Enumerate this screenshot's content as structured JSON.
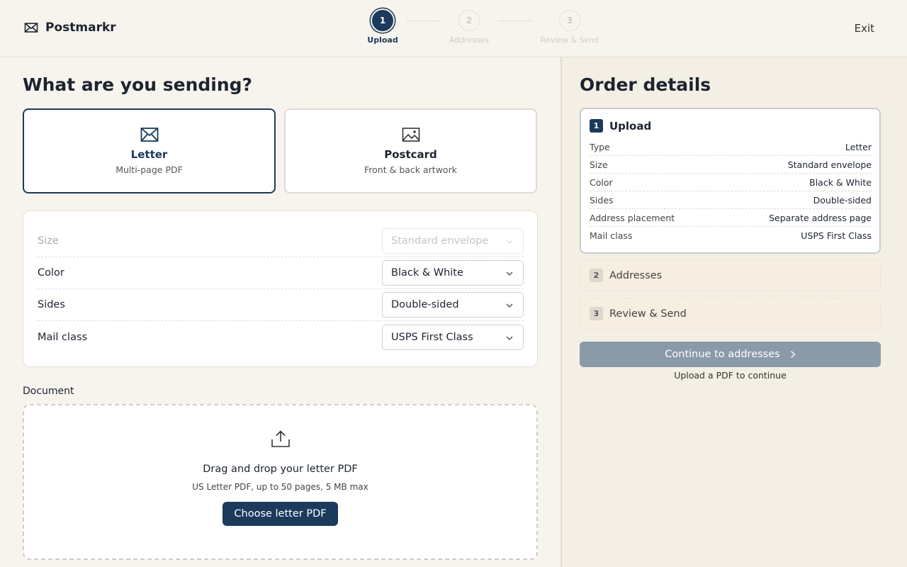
{
  "app": {
    "name": "Postmarkr",
    "exit_label": "Exit"
  },
  "stepper": [
    {
      "number": "1",
      "label": "Upload",
      "state": "active"
    },
    {
      "number": "2",
      "label": "Addresses",
      "state": "inactive"
    },
    {
      "number": "3",
      "label": "Review & Send",
      "state": "inactive"
    }
  ],
  "main": {
    "title": "What are you sending?",
    "types": [
      {
        "name": "Letter",
        "sub": "Multi-page PDF",
        "icon": "envelope-icon",
        "selected": true
      },
      {
        "name": "Postcard",
        "sub": "Front & back artwork",
        "icon": "image-icon",
        "selected": false
      }
    ],
    "options": [
      {
        "label": "Size",
        "value": "Standard envelope",
        "disabled": true
      },
      {
        "label": "Color",
        "value": "Black & White",
        "disabled": false
      },
      {
        "label": "Sides",
        "value": "Double-sided",
        "disabled": false
      },
      {
        "label": "Mail class",
        "value": "USPS First Class",
        "disabled": false
      }
    ],
    "document": {
      "label": "Document",
      "title": "Drag and drop your letter PDF",
      "sub": "US Letter PDF, up to 50 pages, 5 MB max",
      "button": "Choose letter PDF"
    }
  },
  "order": {
    "title": "Order details",
    "section1": {
      "number": "1",
      "title": "Upload",
      "rows": [
        {
          "k": "Type",
          "v": "Letter"
        },
        {
          "k": "Size",
          "v": "Standard envelope"
        },
        {
          "k": "Color",
          "v": "Black & White"
        },
        {
          "k": "Sides",
          "v": "Double-sided"
        },
        {
          "k": "Address placement",
          "v": "Separate address page"
        },
        {
          "k": "Mail class",
          "v": "USPS First Class"
        }
      ]
    },
    "section2": {
      "number": "2",
      "title": "Addresses"
    },
    "section3": {
      "number": "3",
      "title": "Review & Send"
    },
    "continue_label": "Continue to addresses",
    "continue_hint": "Upload a PDF to continue"
  },
  "colors": {
    "primary": "#1b3a5c",
    "background": "#f7f4ee",
    "panel": "#f4efe5",
    "disabled_button": "#8a9aa8"
  }
}
